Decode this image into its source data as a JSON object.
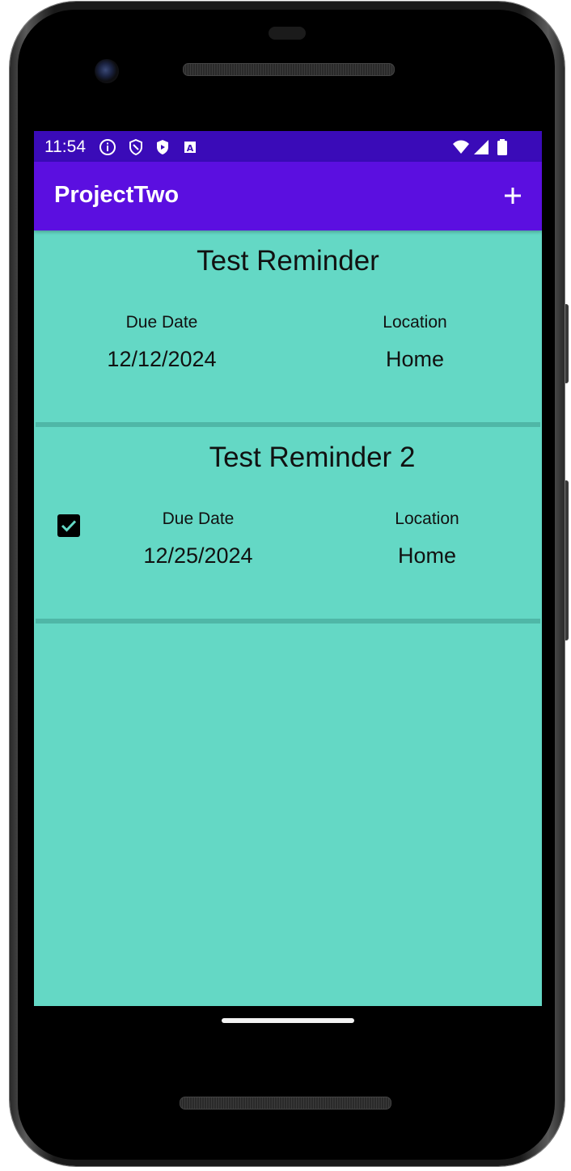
{
  "status_bar": {
    "time": "11:54",
    "left_icons": [
      "info-icon",
      "shield-outline-icon",
      "play-protect-icon",
      "accessibility-a-icon"
    ],
    "right_icons": [
      "wifi-icon",
      "cell-signal-icon",
      "battery-icon"
    ],
    "color": "#3a0bb8"
  },
  "app_bar": {
    "title": "ProjectTwo",
    "add_icon": "plus-icon",
    "color": "#5b0fe0"
  },
  "reminders": [
    {
      "title": "Test Reminder",
      "due_label": "Due Date",
      "due_value": "12/12/2024",
      "location_label": "Location",
      "location_value": "Home",
      "has_checkbox": false
    },
    {
      "title": "Test Reminder 2",
      "due_label": "Due Date",
      "due_value": "12/25/2024",
      "location_label": "Location",
      "location_value": "Home",
      "has_checkbox": true,
      "checked": true
    }
  ],
  "colors": {
    "background": "#64d8c5",
    "divider": "#4fb7a7"
  }
}
